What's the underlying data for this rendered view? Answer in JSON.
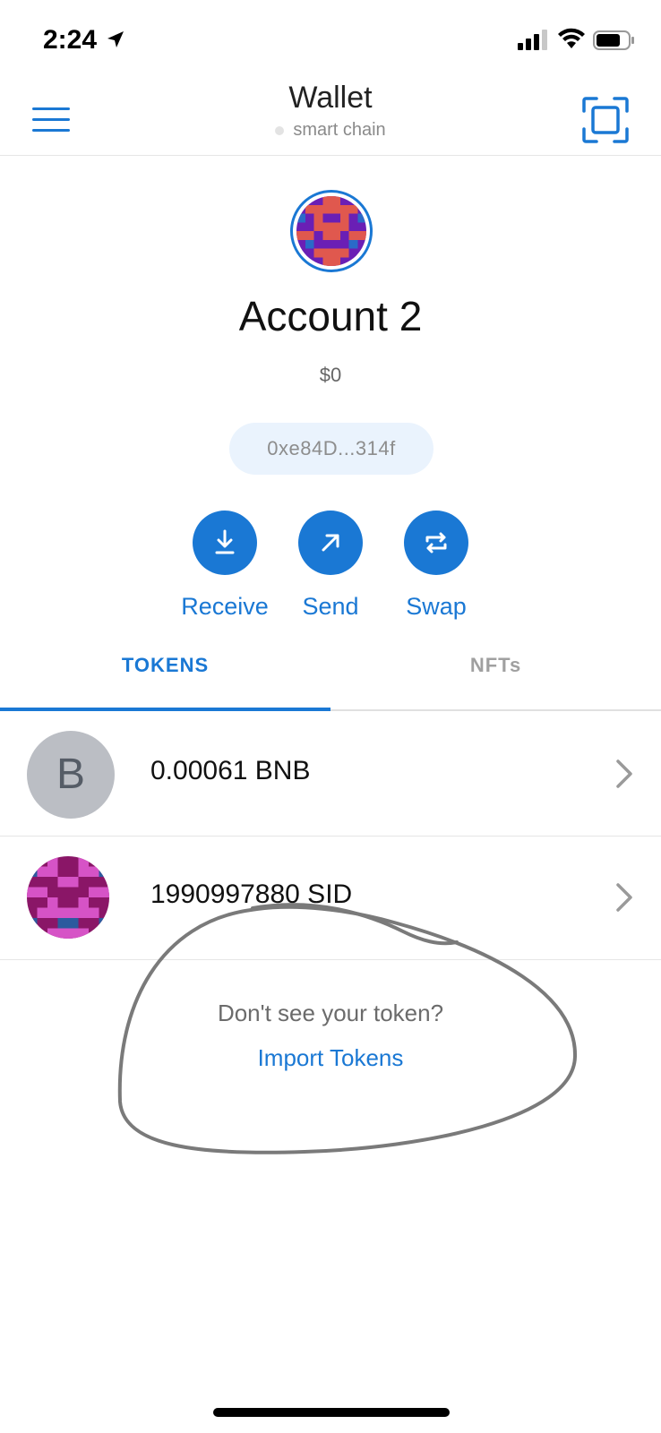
{
  "status_bar": {
    "time": "2:24"
  },
  "header": {
    "title": "Wallet",
    "network": "smart chain"
  },
  "account": {
    "name": "Account 2",
    "balance": "$0",
    "address": "0xe84D...314f"
  },
  "actions": [
    {
      "label": "Receive",
      "icon": "download-icon"
    },
    {
      "label": "Send",
      "icon": "arrow-up-right-icon"
    },
    {
      "label": "Swap",
      "icon": "swap-icon"
    }
  ],
  "tabs": [
    {
      "label": "TOKENS",
      "active": true
    },
    {
      "label": "NFTs",
      "active": false
    }
  ],
  "tokens": [
    {
      "letter": "B",
      "amount": "0.00061 BNB"
    },
    {
      "letter": "",
      "amount": "1990997880 SID"
    }
  ],
  "import": {
    "prompt": "Don't see your token?",
    "link": "Import Tokens"
  },
  "colors": {
    "accent": "#1a78d4",
    "muted": "#8a8a8a",
    "address_bg": "#eaf3fd"
  }
}
